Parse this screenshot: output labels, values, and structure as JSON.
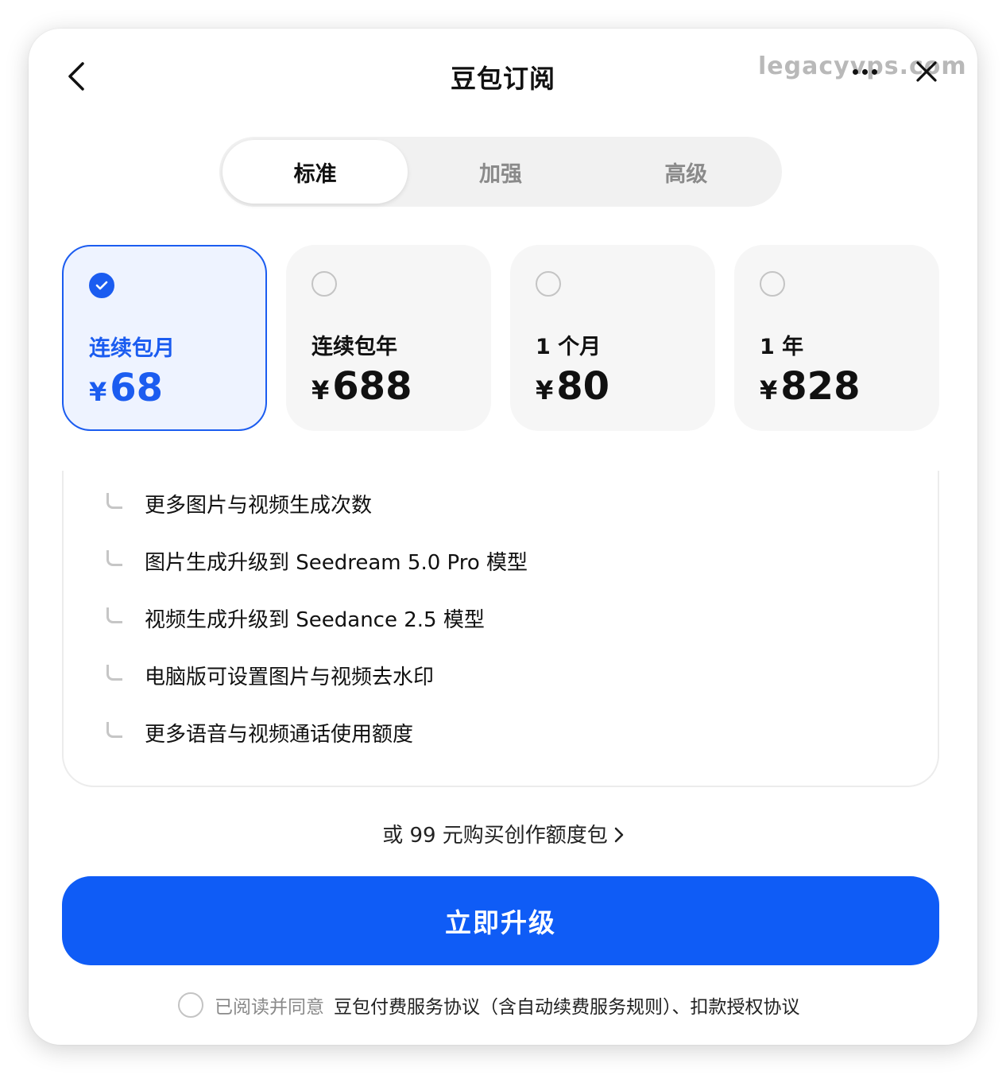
{
  "header": {
    "title": "豆包订阅",
    "watermark": "legacyvps.com",
    "back_icon": "chevron-left-icon",
    "more_icon": "more-horizontal-icon",
    "close_icon": "close-icon"
  },
  "tabs": [
    {
      "label": "标准",
      "active": true
    },
    {
      "label": "加强",
      "active": false
    },
    {
      "label": "高级",
      "active": false
    }
  ],
  "plans": [
    {
      "name": "连续包月",
      "currency": "¥",
      "price": "68",
      "selected": true
    },
    {
      "name": "连续包年",
      "currency": "¥",
      "price": "688",
      "selected": false
    },
    {
      "name": "1 个月",
      "currency": "¥",
      "price": "80",
      "selected": false
    },
    {
      "name": "1 年",
      "currency": "¥",
      "price": "828",
      "selected": false
    }
  ],
  "features": [
    "更多图片与视频生成次数",
    "图片生成升级到 Seedream 5.0 Pro 模型",
    "视频生成升级到 Seedance 2.5 模型",
    "电脑版可设置图片与视频去水印",
    "更多语音与视频通话使用额度"
  ],
  "credit_link": "或 99 元购买创作额度包",
  "upgrade_button": "立即升级",
  "agreement": {
    "prefix": "已阅读并同意",
    "links": "豆包付费服务协议（含自动续费服务规则）、扣款授权协议"
  },
  "colors": {
    "accent": "#0f5cf6",
    "selected_bg": "#eef3ff",
    "card_bg": "#f6f6f6"
  }
}
